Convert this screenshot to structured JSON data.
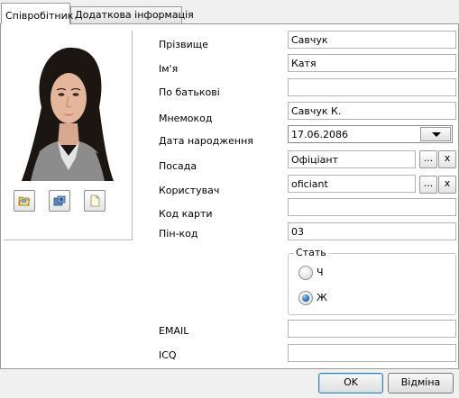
{
  "tabs": [
    {
      "label": "Співробітник",
      "active": true
    },
    {
      "label": "Додаткова інформація",
      "active": false
    }
  ],
  "photo_toolbar": {
    "icons": [
      "open-folder-icon",
      "camera-icon",
      "new-document-icon"
    ]
  },
  "form": {
    "surname": {
      "label": "Прізвище",
      "value": "Савчук"
    },
    "name": {
      "label": "Ім'я",
      "value": "Катя"
    },
    "patronymic": {
      "label": "По батькові",
      "value": ""
    },
    "mnemocode": {
      "label": "Мнемокод",
      "value": "Савчук К."
    },
    "birth_date": {
      "label": "Дата народження",
      "value": "17.06.2086"
    },
    "position": {
      "label": "Посада",
      "value": "Офіціант",
      "browse": "...",
      "clear": "x"
    },
    "user": {
      "label": "Користувач",
      "value": "oficiant",
      "browse": "...",
      "clear": "x"
    },
    "card_code": {
      "label": "Код карти",
      "value": ""
    },
    "pin": {
      "label": "Пін-код",
      "value": "03"
    },
    "sex": {
      "title": "Стать",
      "options": [
        {
          "label": "Ч",
          "checked": false
        },
        {
          "label": "Ж",
          "checked": true
        }
      ]
    },
    "email": {
      "label": "EMAIL",
      "value": ""
    },
    "icq": {
      "label": "ICQ",
      "value": ""
    }
  },
  "buttons": {
    "ok": "OK",
    "cancel": "Відміна"
  },
  "colors": {
    "accent": "#3c7fb1",
    "radio_selected": "#1a5ea8"
  }
}
